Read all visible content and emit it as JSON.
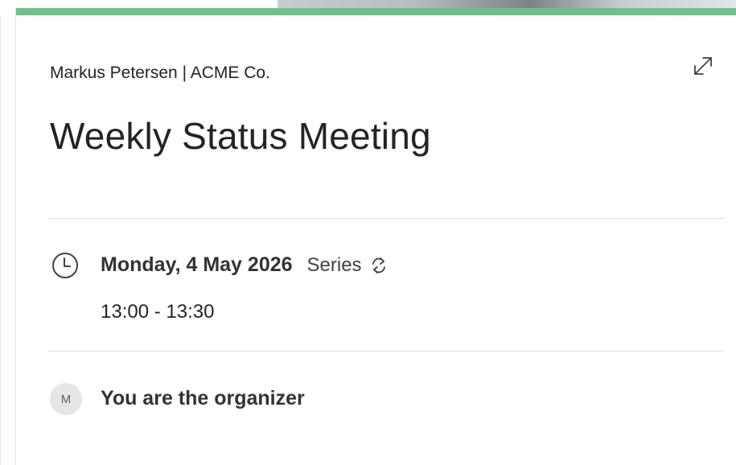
{
  "colors": {
    "accent": "#6fbf8a",
    "text_primary": "#242424",
    "divider": "#e0e0e0",
    "avatar_bg": "#e6e6e6"
  },
  "header": {
    "organizer_line": "Markus Petersen | ACME Co.",
    "expand_icon": "expand-diagonal-icon"
  },
  "meeting": {
    "title": "Weekly Status Meeting",
    "date": "Monday, 4 May 2026",
    "series_label": "Series",
    "series_icon": "recurring-icon",
    "time_range": "13:00 - 13:30",
    "clock_icon": "clock-icon"
  },
  "organizer": {
    "avatar_initial": "M",
    "status": "You are the organizer"
  }
}
